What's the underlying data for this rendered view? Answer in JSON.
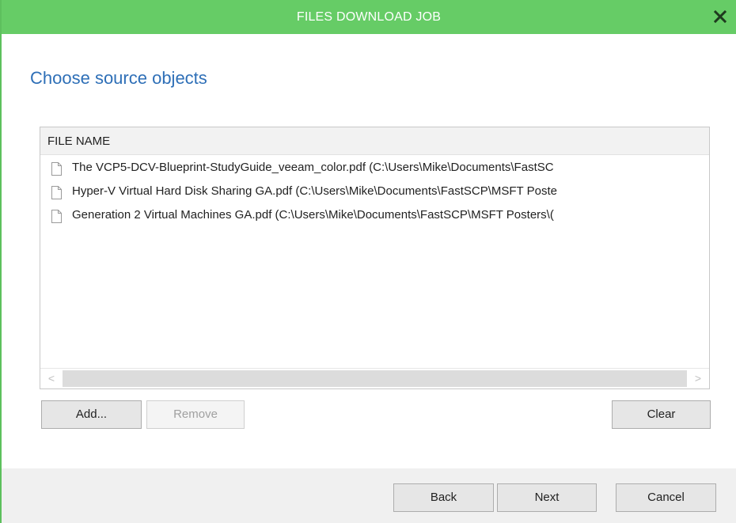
{
  "window": {
    "title": "FILES DOWNLOAD JOB",
    "close_icon": "close-icon",
    "accent_color": "#66cc66"
  },
  "section": {
    "title": "Choose source objects"
  },
  "file_list": {
    "column_header": "FILE NAME",
    "items": [
      {
        "icon": "file-icon",
        "label": "The VCP5-DCV-Blueprint-StudyGuide_veeam_color.pdf (C:\\Users\\Mike\\Documents\\FastSC"
      },
      {
        "icon": "file-icon",
        "label": "Hyper-V Virtual Hard Disk Sharing GA.pdf (C:\\Users\\Mike\\Documents\\FastSCP\\MSFT Poste"
      },
      {
        "icon": "file-icon",
        "label": "Generation 2 Virtual Machines GA.pdf (C:\\Users\\Mike\\Documents\\FastSCP\\MSFT Posters\\("
      }
    ],
    "scroll_left_glyph": "<",
    "scroll_right_glyph": ">"
  },
  "list_buttons": {
    "add": "Add...",
    "remove": "Remove",
    "clear": "Clear"
  },
  "footer_buttons": {
    "back": "Back",
    "next": "Next",
    "cancel": "Cancel"
  }
}
